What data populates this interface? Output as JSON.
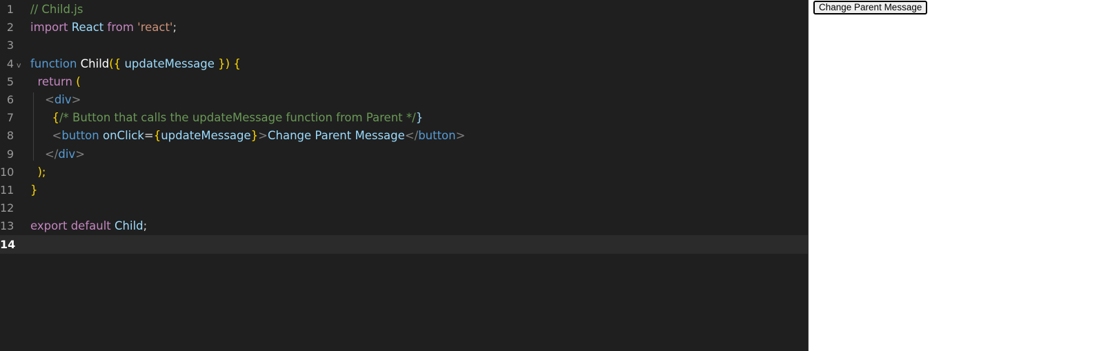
{
  "editor": {
    "current_line": 14,
    "lines": [
      {
        "n": "1",
        "tokens": [
          {
            "t": "// Child.js",
            "c": "comment"
          }
        ]
      },
      {
        "n": "2",
        "tokens": [
          {
            "t": "import",
            "c": "kw"
          },
          {
            "t": " "
          },
          {
            "t": "React",
            "c": "ident"
          },
          {
            "t": " "
          },
          {
            "t": "from",
            "c": "kw"
          },
          {
            "t": " "
          },
          {
            "t": "'react'",
            "c": "str"
          },
          {
            "t": ";",
            "c": "punct"
          }
        ]
      },
      {
        "n": "3",
        "tokens": []
      },
      {
        "n": "4",
        "tokens": [
          {
            "t": "function",
            "c": "fn"
          },
          {
            "t": " "
          },
          {
            "t": "Child",
            "c": "white"
          },
          {
            "t": "({ ",
            "c": "brace"
          },
          {
            "t": "updateMessage",
            "c": "ident"
          },
          {
            "t": " }) {",
            "c": "brace"
          }
        ],
        "fold": "v"
      },
      {
        "n": "5",
        "tokens": [
          {
            "t": "  "
          },
          {
            "t": "return",
            "c": "kw"
          },
          {
            "t": " ("
          }
        ]
      },
      {
        "n": "6",
        "tokens": [
          {
            "t": "    "
          },
          {
            "t": "<",
            "c": "angle"
          },
          {
            "t": "div",
            "c": "tag"
          },
          {
            "t": ">",
            "c": "angle"
          }
        ]
      },
      {
        "n": "7",
        "tokens": [
          {
            "t": "      "
          },
          {
            "t": "{",
            "c": "brace"
          },
          {
            "t": "/* Button that calls the updateMessage function from Parent */",
            "c": "comment"
          },
          {
            "t": "}",
            "c": "ident"
          }
        ]
      },
      {
        "n": "8",
        "tokens": [
          {
            "t": "      "
          },
          {
            "t": "<",
            "c": "angle"
          },
          {
            "t": "button",
            "c": "tag"
          },
          {
            "t": " "
          },
          {
            "t": "onClick",
            "c": "attr"
          },
          {
            "t": "=",
            "c": "punct"
          },
          {
            "t": "{",
            "c": "brace"
          },
          {
            "t": "updateMessage",
            "c": "ident"
          },
          {
            "t": "}",
            "c": "brace"
          },
          {
            "t": ">",
            "c": "angle"
          },
          {
            "t": "Change Parent Message",
            "c": "ident"
          },
          {
            "t": "</",
            "c": "angle"
          },
          {
            "t": "button",
            "c": "tag"
          },
          {
            "t": ">",
            "c": "angle"
          }
        ]
      },
      {
        "n": "9",
        "tokens": [
          {
            "t": "    "
          },
          {
            "t": "</",
            "c": "angle"
          },
          {
            "t": "div",
            "c": "tag"
          },
          {
            "t": ">",
            "c": "angle"
          }
        ]
      },
      {
        "n": "10",
        "tokens": [
          {
            "t": "  "
          },
          {
            "t": ");",
            "c": "brace"
          }
        ]
      },
      {
        "n": "11",
        "tokens": [
          {
            "t": "}",
            "c": "brace"
          }
        ]
      },
      {
        "n": "12",
        "tokens": []
      },
      {
        "n": "13",
        "tokens": [
          {
            "t": "export",
            "c": "kw"
          },
          {
            "t": " "
          },
          {
            "t": "default",
            "c": "kw"
          },
          {
            "t": " "
          },
          {
            "t": "Child",
            "c": "ident"
          },
          {
            "t": ";",
            "c": "punct"
          }
        ]
      },
      {
        "n": "14",
        "tokens": []
      }
    ]
  },
  "preview": {
    "button_label": "Change Parent Message"
  },
  "colors": {
    "editor_bg": "#1f1f1f",
    "comment": "#6a9955",
    "keyword": "#c586c0",
    "function_keyword": "#569cd6",
    "identifier": "#9cdcfe",
    "string": "#ce9178",
    "bracket": "#ffd700"
  }
}
